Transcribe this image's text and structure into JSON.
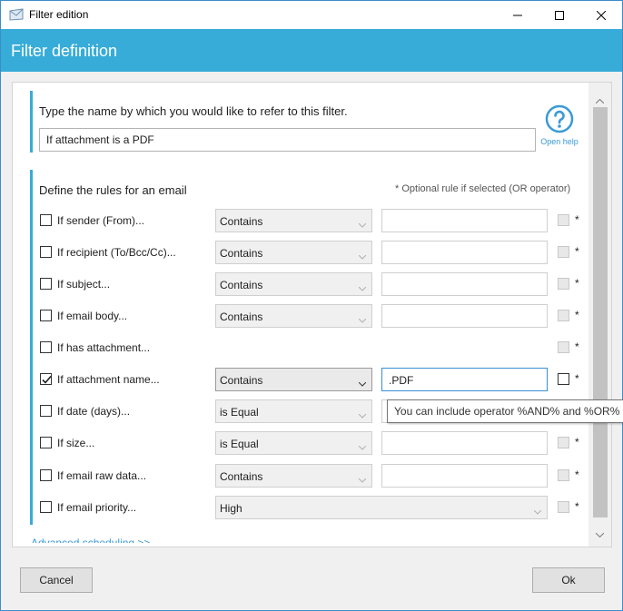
{
  "window": {
    "title": "Filter edition",
    "icon": "envelope-icon",
    "controls": [
      "minimize-icon",
      "maximize-icon",
      "close-icon"
    ]
  },
  "header": {
    "title": "Filter definition",
    "color": "#37acd8"
  },
  "name_section": {
    "prompt": "Type the name by which you would like to refer to this filter.",
    "value": "If attachment is a PDF",
    "help_label": "Open help",
    "help_icon": "question-circle-icon"
  },
  "rules_section": {
    "title": "Define the rules for an email",
    "optional_note": "* Optional rule if selected (OR operator)",
    "rules": [
      {
        "label": "If sender (From)...",
        "checked": false,
        "operator": "Contains",
        "value": "",
        "optional_star": "*"
      },
      {
        "label": "If recipient (To/Bcc/Cc)...",
        "checked": false,
        "operator": "Contains",
        "value": "",
        "optional_star": "*"
      },
      {
        "label": "If subject...",
        "checked": false,
        "operator": "Contains",
        "value": "",
        "optional_star": "*"
      },
      {
        "label": "If email body...",
        "checked": false,
        "operator": "Contains",
        "value": "",
        "optional_star": "*"
      },
      {
        "label": "If has attachment...",
        "checked": false,
        "operator": "",
        "value": "",
        "optional_star": "*"
      },
      {
        "label": "If attachment name...",
        "checked": true,
        "operator": "Contains",
        "value": ".PDF",
        "optional_star": "*"
      },
      {
        "label": "If date (days)...",
        "checked": false,
        "operator": "is Equal",
        "value": "",
        "optional_star": "*"
      },
      {
        "label": "If size...",
        "checked": false,
        "operator": "is Equal",
        "value": "",
        "optional_star": "*"
      },
      {
        "label": "If email raw data...",
        "checked": false,
        "operator": "Contains",
        "value": "",
        "optional_star": "*"
      },
      {
        "label": "If email priority...",
        "checked": false,
        "operator": "High",
        "value": "",
        "optional_star": "*"
      }
    ],
    "tooltip": "You can include operator %AND% and %OR% fo",
    "advanced_link": "Advanced scheduling >>"
  },
  "footer": {
    "cancel_label": "Cancel",
    "ok_label": "Ok"
  }
}
